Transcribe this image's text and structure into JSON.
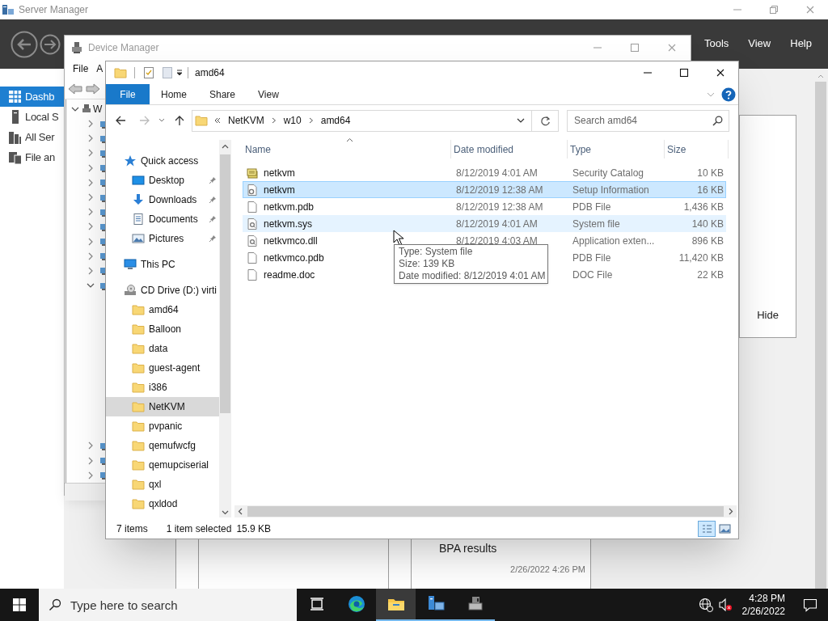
{
  "server_manager": {
    "title": "Server Manager",
    "menu": [
      "Tools",
      "View",
      "Help"
    ],
    "nav": [
      {
        "label": "Dashb",
        "kind": "dashboard",
        "selected": true
      },
      {
        "label": "Local S",
        "kind": "server",
        "selected": false
      },
      {
        "label": "All Ser",
        "kind": "servers",
        "selected": false
      },
      {
        "label": "File an",
        "kind": "files",
        "selected": false
      }
    ],
    "hide_button": "Hide",
    "bpa_title": "BPA results",
    "timestamp": "2/26/2022 4:26 PM"
  },
  "device_manager": {
    "title": "Device Manager",
    "menu": [
      "File",
      "A"
    ],
    "tree": [
      {
        "label": "W",
        "expanded": true,
        "children": [
          {
            "expanded": false
          },
          {
            "expanded": false
          },
          {
            "expanded": false
          },
          {
            "expanded": false
          },
          {
            "expanded": false
          },
          {
            "expanded": false
          },
          {
            "expanded": false
          },
          {
            "expanded": false
          },
          {
            "expanded": false
          },
          {
            "expanded": false
          },
          {
            "expanded": false
          },
          {
            "expanded": true
          },
          {
            "expanded": false
          },
          {
            "expanded": false
          },
          {
            "expanded": false
          }
        ]
      }
    ]
  },
  "explorer": {
    "title": "amd64",
    "ribbon_tabs": [
      {
        "label": "File",
        "selected": true
      },
      {
        "label": "Home",
        "selected": false
      },
      {
        "label": "Share",
        "selected": false
      },
      {
        "label": "View",
        "selected": false
      }
    ],
    "path": [
      "NetKVM",
      "w10",
      "amd64"
    ],
    "search": {
      "placeholder": "Search amd64"
    },
    "nav": [
      {
        "label": "Quick access",
        "kind": "star",
        "selected": false,
        "children": [
          {
            "label": "Desktop",
            "kind": "desktop",
            "pinned": true,
            "selected": false
          },
          {
            "label": "Downloads",
            "kind": "download",
            "pinned": true,
            "selected": false
          },
          {
            "label": "Documents",
            "kind": "documents",
            "pinned": true,
            "selected": false
          },
          {
            "label": "Pictures",
            "kind": "pictures",
            "pinned": true,
            "selected": false
          }
        ]
      },
      {
        "label": "This PC",
        "kind": "pc",
        "selected": false
      },
      {
        "label": "CD Drive (D:) virti",
        "kind": "cd",
        "selected": false,
        "children": [
          {
            "label": "amd64",
            "kind": "folder",
            "selected": false
          },
          {
            "label": "Balloon",
            "kind": "folder",
            "selected": false
          },
          {
            "label": "data",
            "kind": "folder",
            "selected": false
          },
          {
            "label": "guest-agent",
            "kind": "folder",
            "selected": false
          },
          {
            "label": "i386",
            "kind": "folder",
            "selected": false
          },
          {
            "label": "NetKVM",
            "kind": "folder",
            "selected": true
          },
          {
            "label": "pvpanic",
            "kind": "folder",
            "selected": false
          },
          {
            "label": "qemufwcfg",
            "kind": "folder",
            "selected": false
          },
          {
            "label": "qemupciserial",
            "kind": "folder",
            "selected": false
          },
          {
            "label": "qxl",
            "kind": "folder",
            "selected": false
          },
          {
            "label": "qxldod",
            "kind": "folder",
            "selected": false
          }
        ]
      }
    ],
    "columns": [
      "Name",
      "Date modified",
      "Type",
      "Size"
    ],
    "files": [
      {
        "name": "netkvm",
        "kind": "catalog",
        "date": "8/12/2019 4:01 AM",
        "type": "Security Catalog",
        "size": "10 KB",
        "selected": false,
        "hovered": false
      },
      {
        "name": "netkvm",
        "kind": "setup",
        "date": "8/12/2019 12:38 AM",
        "type": "Setup Information",
        "size": "16 KB",
        "selected": true,
        "hovered": false
      },
      {
        "name": "netkvm.pdb",
        "kind": "blank",
        "date": "8/12/2019 12:38 AM",
        "type": "PDB File",
        "size": "1,436 KB",
        "selected": false,
        "hovered": false
      },
      {
        "name": "netkvm.sys",
        "kind": "system",
        "date": "8/12/2019 4:01 AM",
        "type": "System file",
        "size": "140 KB",
        "selected": false,
        "hovered": true
      },
      {
        "name": "netkvmco.dll",
        "kind": "system",
        "date": "8/12/2019 4:03 AM",
        "type": "Application exten...",
        "size": "896 KB",
        "selected": false,
        "hovered": false
      },
      {
        "name": "netkvmco.pdb",
        "kind": "blank",
        "type": "PDB File",
        "size": "11,420 KB",
        "selected": false,
        "hovered": false
      },
      {
        "name": "readme.doc",
        "kind": "blank",
        "type": "DOC File",
        "size": "22 KB",
        "selected": false,
        "hovered": false
      }
    ],
    "tooltip": [
      "Type: System file",
      "Size: 139 KB",
      "Date modified: 8/12/2019 4:01 AM"
    ],
    "status": {
      "count": "7 items",
      "selection": "1 item selected",
      "size": "15.9 KB"
    },
    "view_buttons": [
      {
        "kind": "details",
        "selected": true
      },
      {
        "kind": "large-icons",
        "selected": false
      }
    ]
  },
  "taskbar": {
    "search_placeholder": "Type here to search",
    "apps": [
      {
        "kind": "task-view",
        "running": false,
        "active": false
      },
      {
        "kind": "edge",
        "running": false,
        "active": false
      },
      {
        "kind": "explorer",
        "running": true,
        "active": true
      },
      {
        "kind": "server-manager",
        "running": true,
        "active": false
      },
      {
        "kind": "device-manager",
        "running": true,
        "active": false
      }
    ],
    "time": "4:28 PM",
    "date": "2/26/2022"
  }
}
